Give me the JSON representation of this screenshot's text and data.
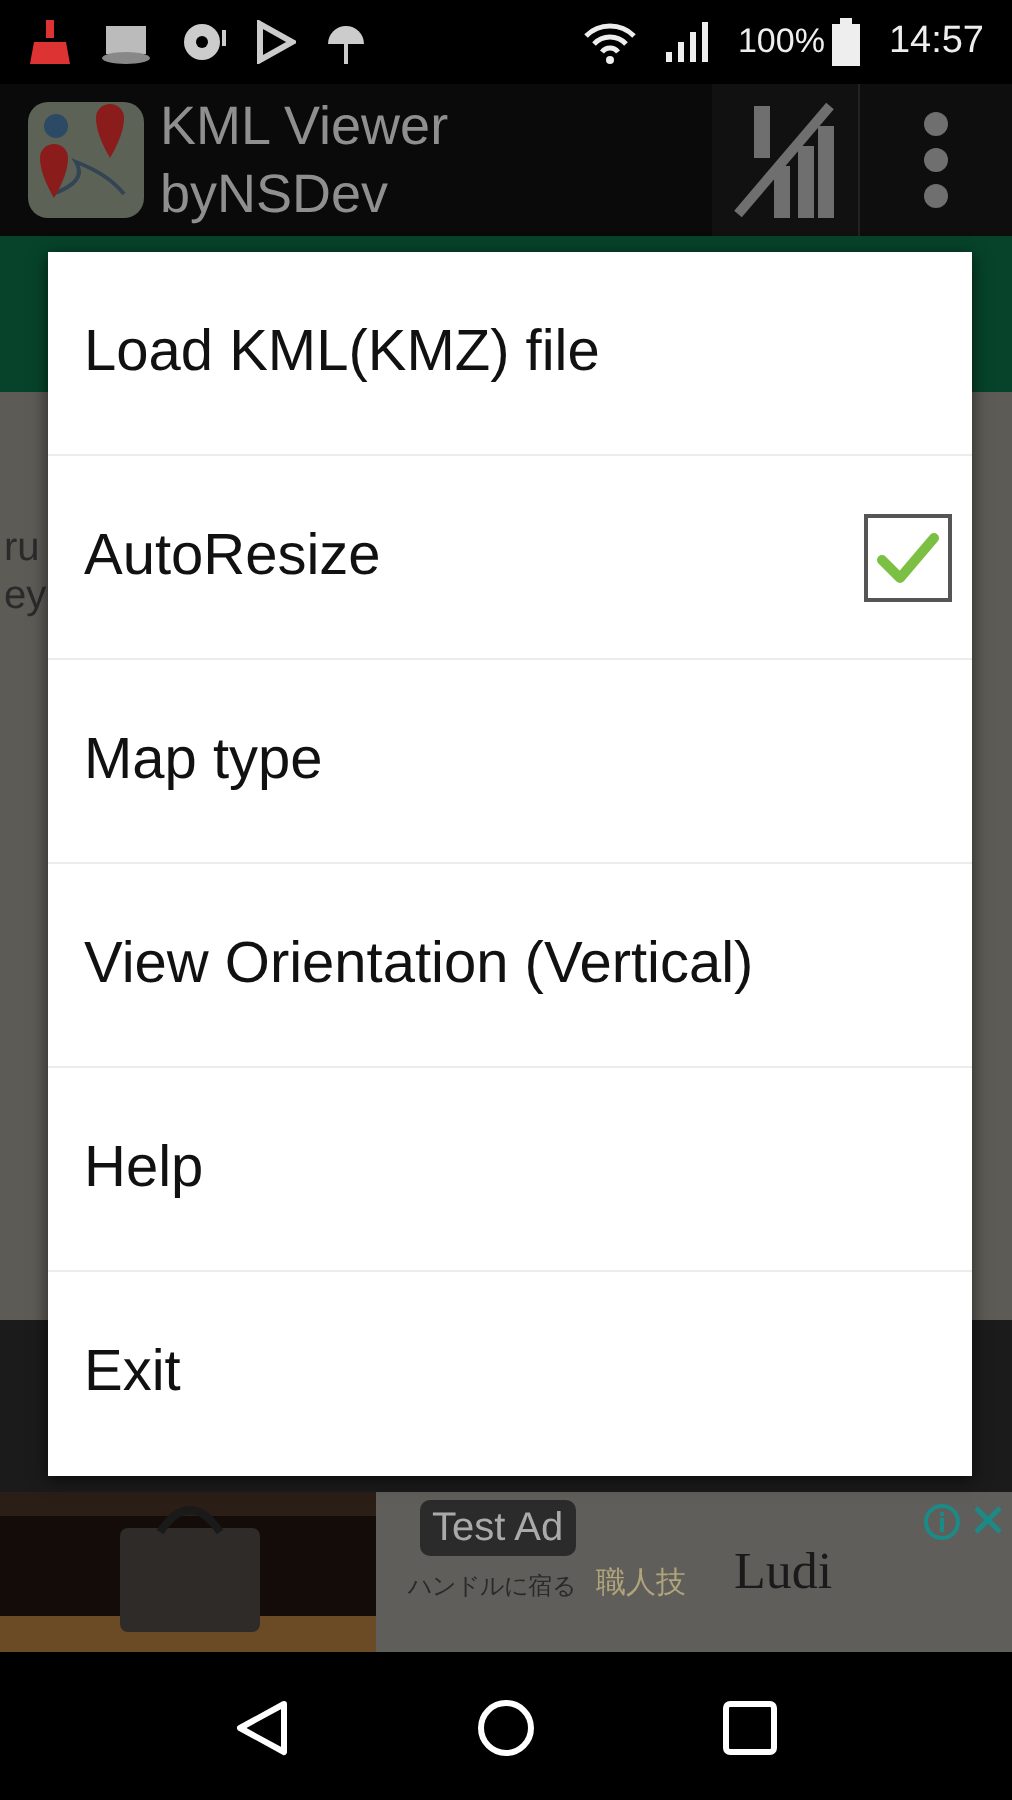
{
  "status_bar": {
    "battery": "100%",
    "time": "14:57"
  },
  "app_bar": {
    "title": "KML Viewer",
    "subtitle": "byNSDev"
  },
  "background_text": [
    "ru",
    "ey"
  ],
  "menu": {
    "items": [
      {
        "kind": "plain",
        "label": "Load KML(KMZ) file"
      },
      {
        "kind": "checkbox",
        "label": "AutoResize",
        "checked": true
      },
      {
        "kind": "plain",
        "label": "Map type"
      },
      {
        "kind": "plain",
        "label": "View Orientation (Vertical)"
      },
      {
        "kind": "plain",
        "label": "Help"
      },
      {
        "kind": "plain",
        "label": "Exit"
      }
    ]
  },
  "ad": {
    "badge": "Test Ad",
    "tagline": "ハンドルに宿る",
    "highlight": "職人技",
    "brand": "Ludi"
  }
}
